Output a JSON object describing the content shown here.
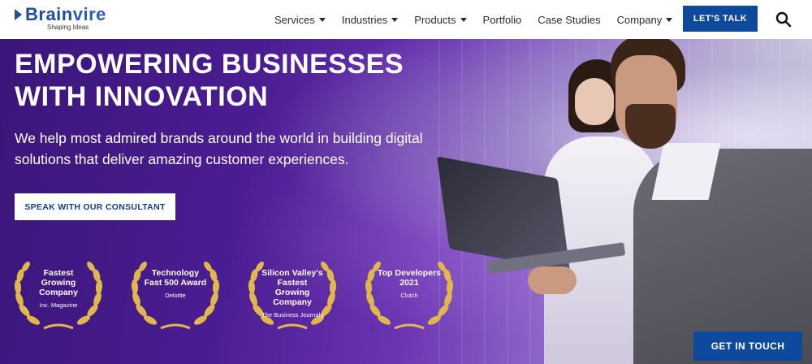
{
  "header": {
    "logo_text_a": "Brain",
    "logo_text_b": "vire",
    "logo_tagline": "Shaping Ideas",
    "nav": [
      {
        "label": "Services",
        "has_dropdown": true
      },
      {
        "label": "Industries",
        "has_dropdown": true
      },
      {
        "label": "Products",
        "has_dropdown": true
      },
      {
        "label": "Portfolio",
        "has_dropdown": false
      },
      {
        "label": "Case Studies",
        "has_dropdown": false
      },
      {
        "label": "Company",
        "has_dropdown": true
      }
    ],
    "cta_label": "LET'S TALK",
    "search_icon": "search-icon"
  },
  "hero": {
    "headline": "EMPOWERING BUSINESSES WITH INNOVATION",
    "subtext": "We help most admired brands around the world in building digital solutions that deliver amazing customer experiences.",
    "consult_label": "SPEAK WITH OUR CONSULTANT",
    "awards": [
      {
        "title": "Fastest Growing Company",
        "source": "Inc. Magazine"
      },
      {
        "title": "Technology Fast 500 Award",
        "source": "Deloitte"
      },
      {
        "title": "Silicon Valley's Fastest Growing Company",
        "source": "The Business Journals"
      },
      {
        "title": "Top Developers 2021",
        "source": "Clutch"
      }
    ],
    "get_in_touch_label": "GET IN TOUCH"
  },
  "colors": {
    "brand_blue": "#0d4a9e",
    "laurel_gold": "#e0b84a",
    "hero_purple": "#4a1c91"
  }
}
